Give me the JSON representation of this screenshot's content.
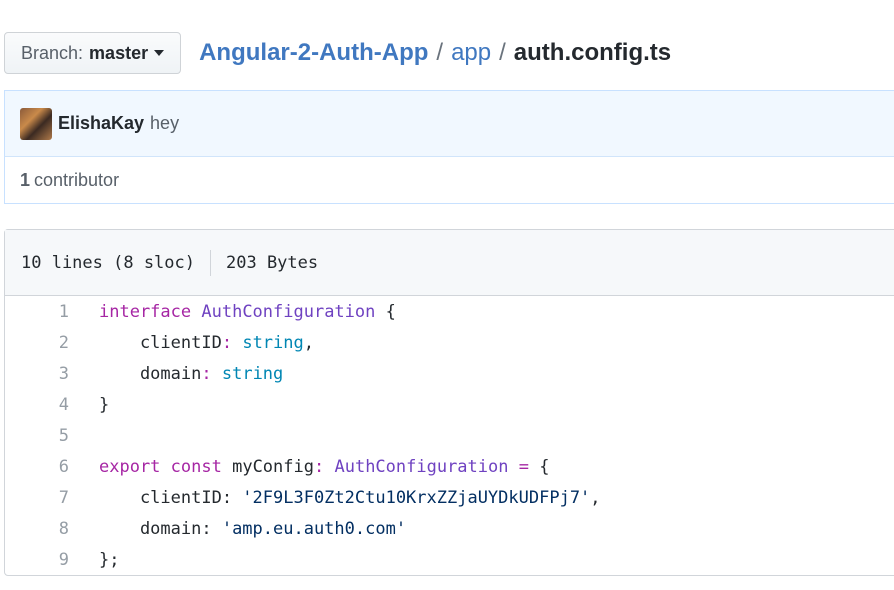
{
  "file_nav": {
    "branch_prefix": "Branch:",
    "branch_name": "master",
    "repo": "Angular-2-Auth-App",
    "folder": "app",
    "file": "auth.config.ts",
    "separator": "/"
  },
  "commit": {
    "author": "ElishaKay",
    "message": "hey"
  },
  "contributors": {
    "count": "1",
    "label": "contributor"
  },
  "file_info": {
    "lines": "10 lines (8 sloc)",
    "size": "203 Bytes"
  },
  "code_lines": [
    {
      "num": "1",
      "parts": [
        [
          "k",
          "interface"
        ],
        [
          "p",
          " "
        ],
        [
          "t",
          "AuthConfiguration"
        ],
        [
          "p",
          " {"
        ]
      ]
    },
    {
      "num": "2",
      "parts": [
        [
          "p",
          "    clientID"
        ],
        [
          "k",
          ":"
        ],
        [
          "p",
          " "
        ],
        [
          "b",
          "string"
        ],
        [
          "p",
          ","
        ]
      ]
    },
    {
      "num": "3",
      "parts": [
        [
          "p",
          "    domain"
        ],
        [
          "k",
          ":"
        ],
        [
          "p",
          " "
        ],
        [
          "b",
          "string"
        ]
      ]
    },
    {
      "num": "4",
      "parts": [
        [
          "p",
          "}"
        ]
      ]
    },
    {
      "num": "5",
      "parts": []
    },
    {
      "num": "6",
      "parts": [
        [
          "k",
          "export"
        ],
        [
          "p",
          " "
        ],
        [
          "k",
          "const"
        ],
        [
          "p",
          " myConfig"
        ],
        [
          "k",
          ":"
        ],
        [
          "p",
          " "
        ],
        [
          "t",
          "AuthConfiguration"
        ],
        [
          "p",
          " "
        ],
        [
          "k",
          "="
        ],
        [
          "p",
          " {"
        ]
      ]
    },
    {
      "num": "7",
      "parts": [
        [
          "p",
          "    clientID: "
        ],
        [
          "s",
          "'2F9L3F0Zt2Ctu10KrxZZjaUYDkUDFPj7'"
        ],
        [
          "p",
          ","
        ]
      ]
    },
    {
      "num": "8",
      "parts": [
        [
          "p",
          "    domain: "
        ],
        [
          "s",
          "'amp.eu.auth0.com'"
        ]
      ]
    },
    {
      "num": "9",
      "parts": [
        [
          "p",
          "};"
        ]
      ]
    }
  ],
  "colors": {
    "link": "#4078c0",
    "keyword": "#a626a4",
    "type": "#6f42c1",
    "builtin": "#0086b3",
    "string": "#032f62"
  }
}
